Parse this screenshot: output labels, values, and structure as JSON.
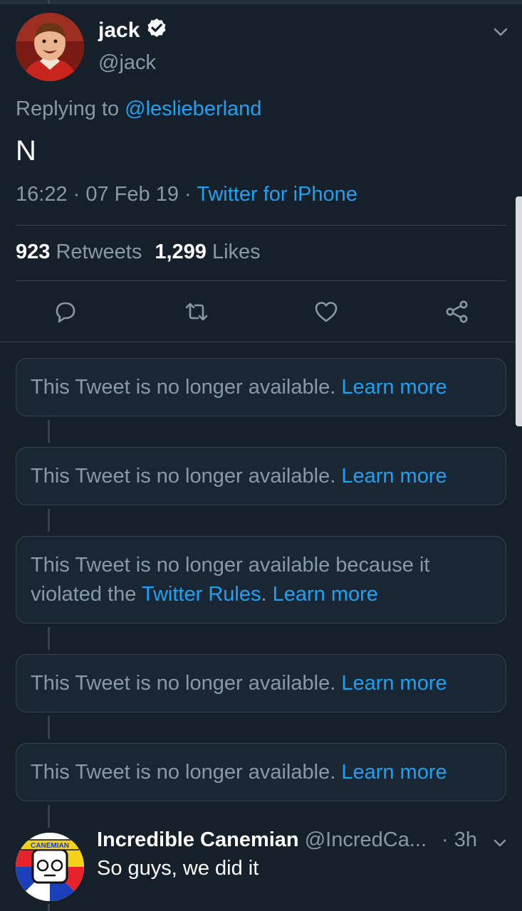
{
  "tweet": {
    "author_name": "jack",
    "author_handle": "@jack",
    "replying_prefix": "Replying to ",
    "replying_to": "@leslieberland",
    "text": "N",
    "time": "16:22",
    "date": "07 Feb 19",
    "separator": " · ",
    "source": "Twitter for iPhone",
    "retweet_count": "923",
    "retweet_label": "Retweets",
    "like_count": "1,299",
    "like_label": "Likes"
  },
  "actions": {
    "reply_icon": "reply-icon",
    "retweet_icon": "retweet-icon",
    "like_icon": "heart-icon",
    "share_icon": "share-icon"
  },
  "unavailable": [
    {
      "text": "This Tweet is no longer available. ",
      "learn_more": "Learn more"
    },
    {
      "text": "This Tweet is no longer available. ",
      "learn_more": "Learn more"
    },
    {
      "text_before": "This Tweet is no longer available because it violated the ",
      "rules_link": "Twitter Rules",
      "text_after": ". ",
      "learn_more": "Learn more"
    },
    {
      "text": "This Tweet is no longer available. ",
      "learn_more": "Learn more"
    },
    {
      "text": "This Tweet is no longer available. ",
      "learn_more": "Learn more"
    }
  ],
  "reply": {
    "name": "Incredible Canemian",
    "handle": "@IncredCa...",
    "time": "· 3h",
    "text": "So guys, we did it",
    "avatar_badge": "CANEMIAN"
  },
  "colors": {
    "background": "#15202b",
    "card": "#192734",
    "border": "#38444d",
    "accent": "#1da1f2",
    "secondary_text": "#8899a6"
  }
}
